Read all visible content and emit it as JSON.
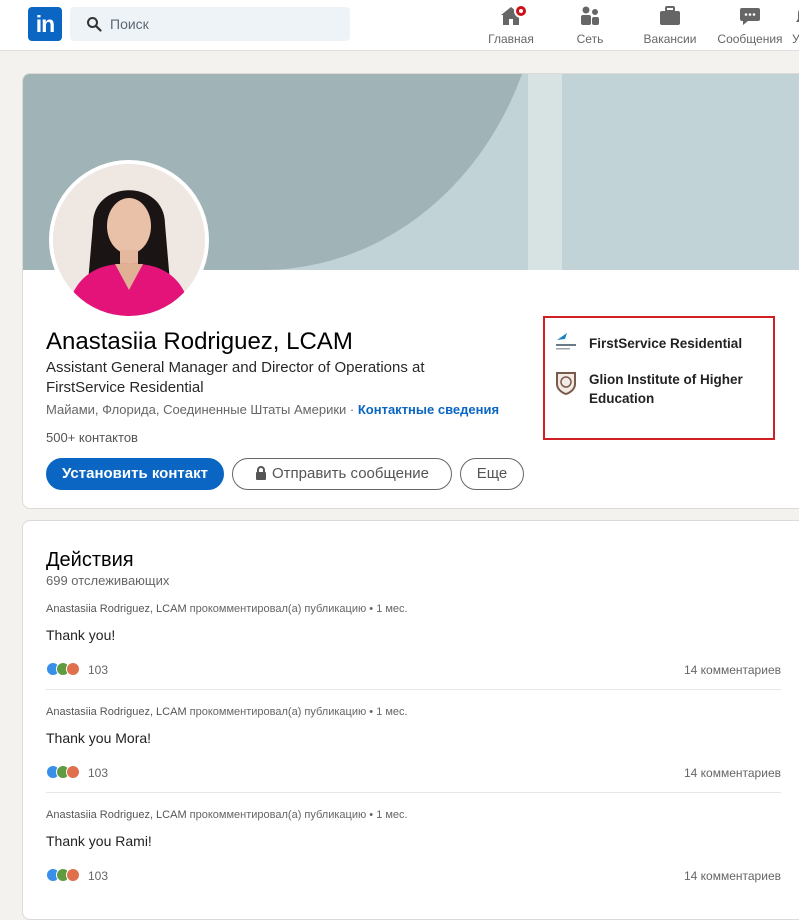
{
  "nav": {
    "logo": "in",
    "search_placeholder": "Поиск",
    "items": [
      {
        "label": "Главная",
        "icon": "home-icon"
      },
      {
        "label": "Сеть",
        "icon": "network-icon"
      },
      {
        "label": "Вакансии",
        "icon": "briefcase-icon"
      },
      {
        "label": "Сообщения",
        "icon": "messaging-icon"
      },
      {
        "label": "У",
        "icon": "notifications-icon"
      }
    ]
  },
  "profile": {
    "name": "Anastasiia Rodriguez, LCAM",
    "headline": "Assistant General Manager and Director of Operations at FirstService Residential",
    "location": "Майами, Флорида, Соединенные Штаты Америки",
    "separator": " · ",
    "contact_info": "Контактные сведения",
    "connections": "500+ контактов",
    "buttons": {
      "connect": "Установить контакт",
      "message": "Отправить сообщение",
      "more": "Еще"
    },
    "organizations": [
      {
        "name": "FirstService Residential"
      },
      {
        "name": "Glion Institute of Higher Education"
      }
    ]
  },
  "activity": {
    "title": "Действия",
    "followers": "699 отслеживающих",
    "posts": [
      {
        "author": "Anastasiia Rodriguez, LCAM",
        "action": " прокомментировал(а) публикацию • 1 мес.",
        "text": "Thank you!",
        "reactions": "103",
        "comments": "14 комментариев"
      },
      {
        "author": "Anastasiia Rodriguez, LCAM",
        "action": " прокомментировал(а) публикацию • 1 мес.",
        "text": "Thank you Mora!",
        "reactions": "103",
        "comments": "14 комментариев"
      },
      {
        "author": "Anastasiia Rodriguez, LCAM",
        "action": " прокомментировал(а) публикацию • 1 мес.",
        "text": "Thank you Rami!",
        "reactions": "103",
        "comments": "14 комментариев"
      }
    ]
  },
  "colors": {
    "brand": "#0a66c2",
    "highlight_border": "#d11f26",
    "badge": "#cc1016"
  }
}
